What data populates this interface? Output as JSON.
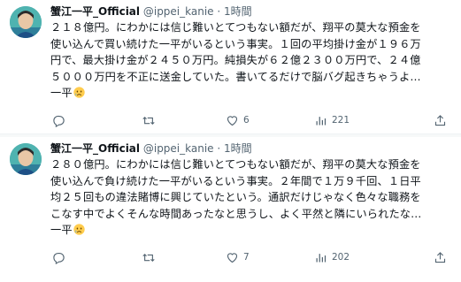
{
  "tweets": [
    {
      "name": "蟹江一平_Official",
      "handle": "@ippei_kanie",
      "sep": "·",
      "time": "1時間",
      "lines": [
        "２１８億円。にわかには信じ難いとてつもない額だが、翔平の莫大な預金を",
        "使い込んで買い続けた一平がいるという事実。１回の平均掛け金が１９６万",
        "円で、最大掛け金が２４５０万円。純損失が６２億２３００万円で、２４億",
        "５０００万円を不正に送金していた。書いてるだけで脳バグ起きちゃうよ…",
        "一平"
      ],
      "emoji": "sad-face-emoji",
      "replies": "",
      "reposts": "",
      "likes": "6",
      "views": "221"
    },
    {
      "name": "蟹江一平_Official",
      "handle": "@ippei_kanie",
      "sep": "·",
      "time": "1時間",
      "lines": [
        "２８０億円。にわかには信じ難いとてつもない額だが、翔平の莫大な預金を",
        "使い込んで負け続けた一平がいるという事実。２年間で１万９千回、１日平",
        "均２５回もの違法賭博に興じていたという。通訳だけじゃなく色々な職務を",
        "こなす中でよくそんな時間あったなと思うし、よく平然と隣にいられたな…",
        "一平"
      ],
      "emoji": "sad-face-emoji",
      "replies": "",
      "reposts": "",
      "likes": "7",
      "views": "202"
    }
  ],
  "icons": {
    "reply": "reply-icon",
    "repost": "repost-icon",
    "like": "heart-icon",
    "views": "views-bar-chart-icon",
    "share": "share-icon"
  },
  "colors": {
    "text": "#0f1419",
    "muted": "#536471",
    "divider": "#eff3f4"
  }
}
